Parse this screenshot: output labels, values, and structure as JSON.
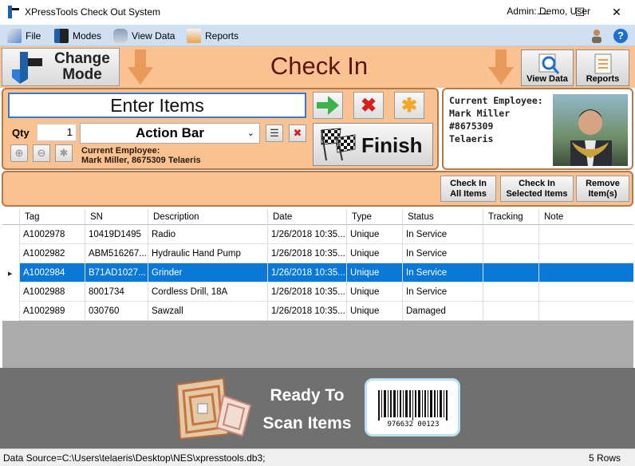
{
  "window": {
    "title": "XPressTools Check Out System",
    "minimize": "—",
    "maximize": "☐",
    "close": "✕"
  },
  "menu": {
    "items": [
      "File",
      "Modes",
      "View Data",
      "Reports"
    ],
    "admin": "Admin: Demo, User",
    "help": "?"
  },
  "header": {
    "change_mode_line1": "Change",
    "change_mode_line2": "Mode",
    "title": "Check In",
    "view_data": "View Data",
    "reports": "Reports"
  },
  "entry": {
    "placeholder": "Enter Items",
    "qty_label": "Qty",
    "qty_value": "1",
    "action_bar": "Action Bar",
    "current_employee_label": "Current Employee:",
    "current_employee_value": "Mark Miller, 8675309 Telaeris",
    "finish": "Finish"
  },
  "employee": {
    "line1": "Current Employee:",
    "line2": "Mark Miller",
    "line3": "#8675309",
    "line4": "Telaeris"
  },
  "actions": {
    "check_in_all": [
      "Check In",
      "All Items"
    ],
    "check_in_selected": [
      "Check In",
      "Selected Items"
    ],
    "remove": [
      "Remove",
      "Item(s)"
    ]
  },
  "table": {
    "columns": [
      "Tag",
      "SN",
      "Description",
      "Date",
      "Type",
      "Status",
      "Tracking",
      "Note"
    ],
    "rows": [
      [
        "A1002978",
        "10419D1495",
        "Radio",
        "1/26/2018 10:35...",
        "Unique",
        "In Service",
        "",
        ""
      ],
      [
        "A1002982",
        "ABM516267...",
        "Hydraulic Hand Pump",
        "1/26/2018 10:35...",
        "Unique",
        "In Service",
        "",
        ""
      ],
      [
        "A1002984",
        "B71AD1027...",
        "Grinder",
        "1/26/2018 10:35...",
        "Unique",
        "In Service",
        "",
        ""
      ],
      [
        "A1002988",
        "8001734",
        "Cordless Drill, 18A",
        "1/26/2018 10:35...",
        "Unique",
        "In Service",
        "",
        ""
      ],
      [
        "A1002989",
        "030760",
        "Sawzall",
        "1/26/2018 10:35...",
        "Unique",
        "Damaged",
        "",
        ""
      ]
    ],
    "selected_row": 2
  },
  "banner": {
    "line1": "Ready To",
    "line2": "Scan Items",
    "barcode_number": "976632 00123"
  },
  "status": {
    "data_source": "Data Source=C:\\Users\\telaeris\\Desktop\\NES\\xpresstools.db3;",
    "rows": "5 Rows"
  },
  "colors": {
    "panel": "#fbc291",
    "panel_border": "#b07a4c",
    "title": "#5a1512",
    "selection": "#0a78d7",
    "menubar": "#cfe0f3"
  }
}
